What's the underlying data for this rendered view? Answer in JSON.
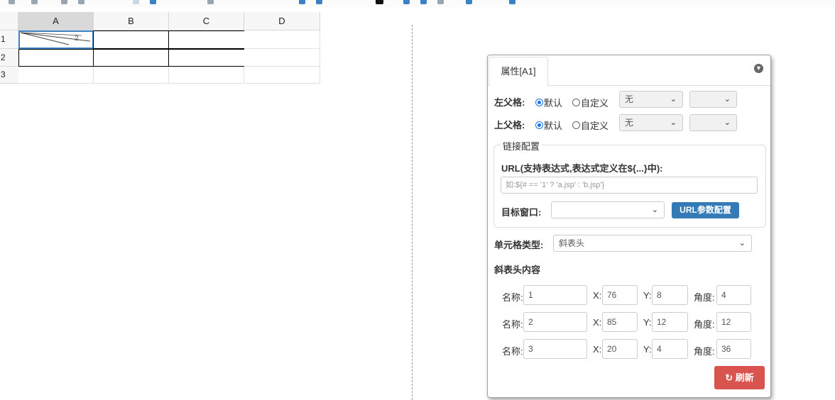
{
  "toolbar": {
    "icons": [
      "undo-icon",
      "redo-icon",
      "copy-icon",
      "paste-icon",
      "format-icon",
      "chart-icon",
      "align-icon",
      "fill-color-icon",
      "border-icon",
      "merge-icon",
      "link-icon",
      "preview-icon"
    ]
  },
  "sheet": {
    "columns": [
      "A",
      "B",
      "C",
      "D"
    ],
    "rows": [
      "1",
      "2",
      "3"
    ],
    "selected_cell": "A1",
    "diagonal_labels": [
      "2"
    ]
  },
  "panel": {
    "tab_label": "属性[A1]",
    "left_parent": {
      "label": "左父格:",
      "opt_default": "默认",
      "opt_custom": "自定义",
      "select1_value": "无",
      "select2_value": ""
    },
    "top_parent": {
      "label": "上父格:",
      "opt_default": "默认",
      "opt_custom": "自定义",
      "select1_value": "无",
      "select2_value": ""
    },
    "link": {
      "legend": "链接配置",
      "url_label": "URL(支持表达式,表达式定义在${...}中):",
      "url_placeholder": "如:${# == '1' ? 'a.jsp' : 'b.jsp'}",
      "target_label": "目标窗口:",
      "target_value": "",
      "param_button": "URL参数配置"
    },
    "cell_type": {
      "label": "单元格类型:",
      "value": "斜表头"
    },
    "diag": {
      "heading": "斜表头内容",
      "name_label": "名称:",
      "x_label": "X:",
      "y_label": "Y:",
      "angle_label": "角度:",
      "rows": [
        {
          "name": "1",
          "x": "76",
          "y": "8",
          "angle": "4"
        },
        {
          "name": "2",
          "x": "85",
          "y": "12",
          "angle": "12"
        },
        {
          "name": "3",
          "x": "20",
          "y": "4",
          "angle": "36"
        }
      ]
    },
    "refresh_button": "刷新"
  }
}
